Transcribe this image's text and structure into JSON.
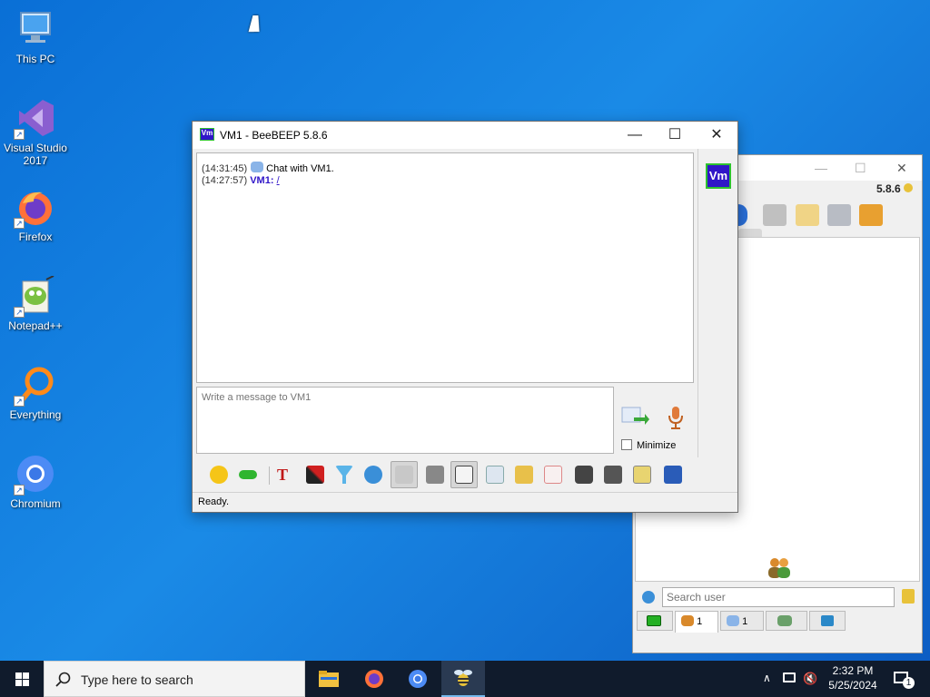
{
  "desktop": {
    "icons": [
      {
        "label": "This PC"
      },
      {
        "label": "Visual Studio 2017"
      },
      {
        "label": "Firefox"
      },
      {
        "label": "Notepad++"
      },
      {
        "label": "Everything"
      },
      {
        "label": "Chromium"
      }
    ]
  },
  "chat_window": {
    "title": "VM1 - BeeBEEP 5.8.6",
    "badge": "Vm",
    "controls": {
      "minimize": "—",
      "maximize": "☐",
      "close": "✕"
    },
    "log": [
      {
        "time": "(14:31:45)",
        "text": "Chat with VM1."
      },
      {
        "time": "(14:27:57)",
        "sender": "VM1:",
        "text": "/"
      }
    ],
    "message_placeholder": "Write a message to VM1",
    "minimize_label": "Minimize",
    "minimize_checked": false,
    "status": "Ready."
  },
  "main_window": {
    "version": "5.8.6",
    "controls": {
      "minimize": "—",
      "maximize": "☐",
      "close": "✕"
    },
    "search_placeholder": "Search user",
    "tabs": [
      {
        "count": "1"
      },
      {
        "count": "1"
      }
    ]
  },
  "taskbar": {
    "search_text": "Type here to search",
    "time": "2:32 PM",
    "date": "5/25/2024",
    "notification_count": "1"
  },
  "colors": {
    "accent": "#3016c8",
    "badge_border": "#2ec22e",
    "desktop_blue": "#0a6fd6",
    "taskbar": "#101b2c"
  }
}
